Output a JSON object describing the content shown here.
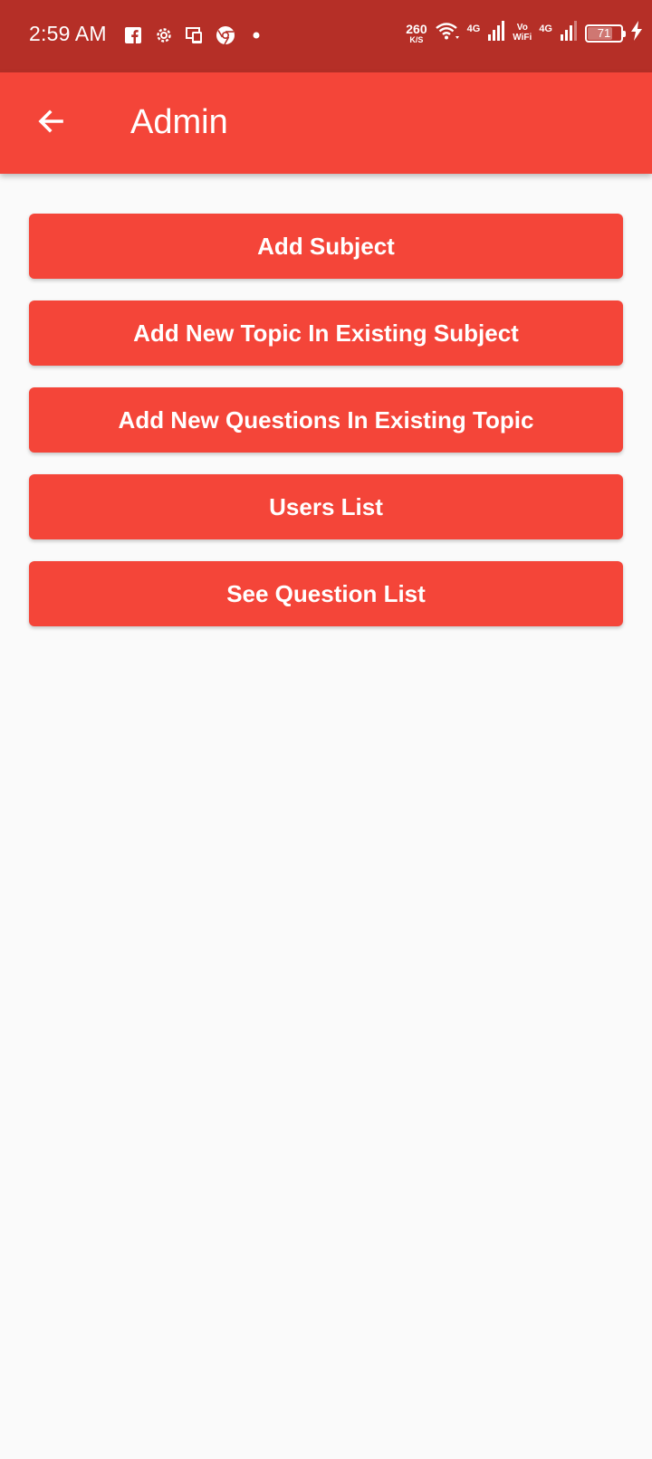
{
  "status_bar": {
    "time": "2:59 AM",
    "left_icons": [
      "facebook-icon",
      "settings-gear-icon",
      "screen-mirror-icon",
      "chrome-icon",
      "dot-icon"
    ],
    "net_speed_value": "260",
    "net_speed_unit": "K/S",
    "network1": "4G",
    "vo_line1": "Vo",
    "vo_line2": "WiFi",
    "network2": "4G",
    "battery_level": "71",
    "battery_fraction": 0.71
  },
  "appbar": {
    "back_icon": "arrow-left-icon",
    "title": "Admin"
  },
  "menu": {
    "items": [
      {
        "label": "Add Subject"
      },
      {
        "label": "Add New Topic In Existing Subject"
      },
      {
        "label": "Add New Questions In Existing Topic"
      },
      {
        "label": "Users List"
      },
      {
        "label": "See Question List"
      }
    ]
  },
  "colors": {
    "status_bar": "#b52f27",
    "primary": "#f44539",
    "background": "#fafafa",
    "text_on_primary": "#ffffff"
  }
}
